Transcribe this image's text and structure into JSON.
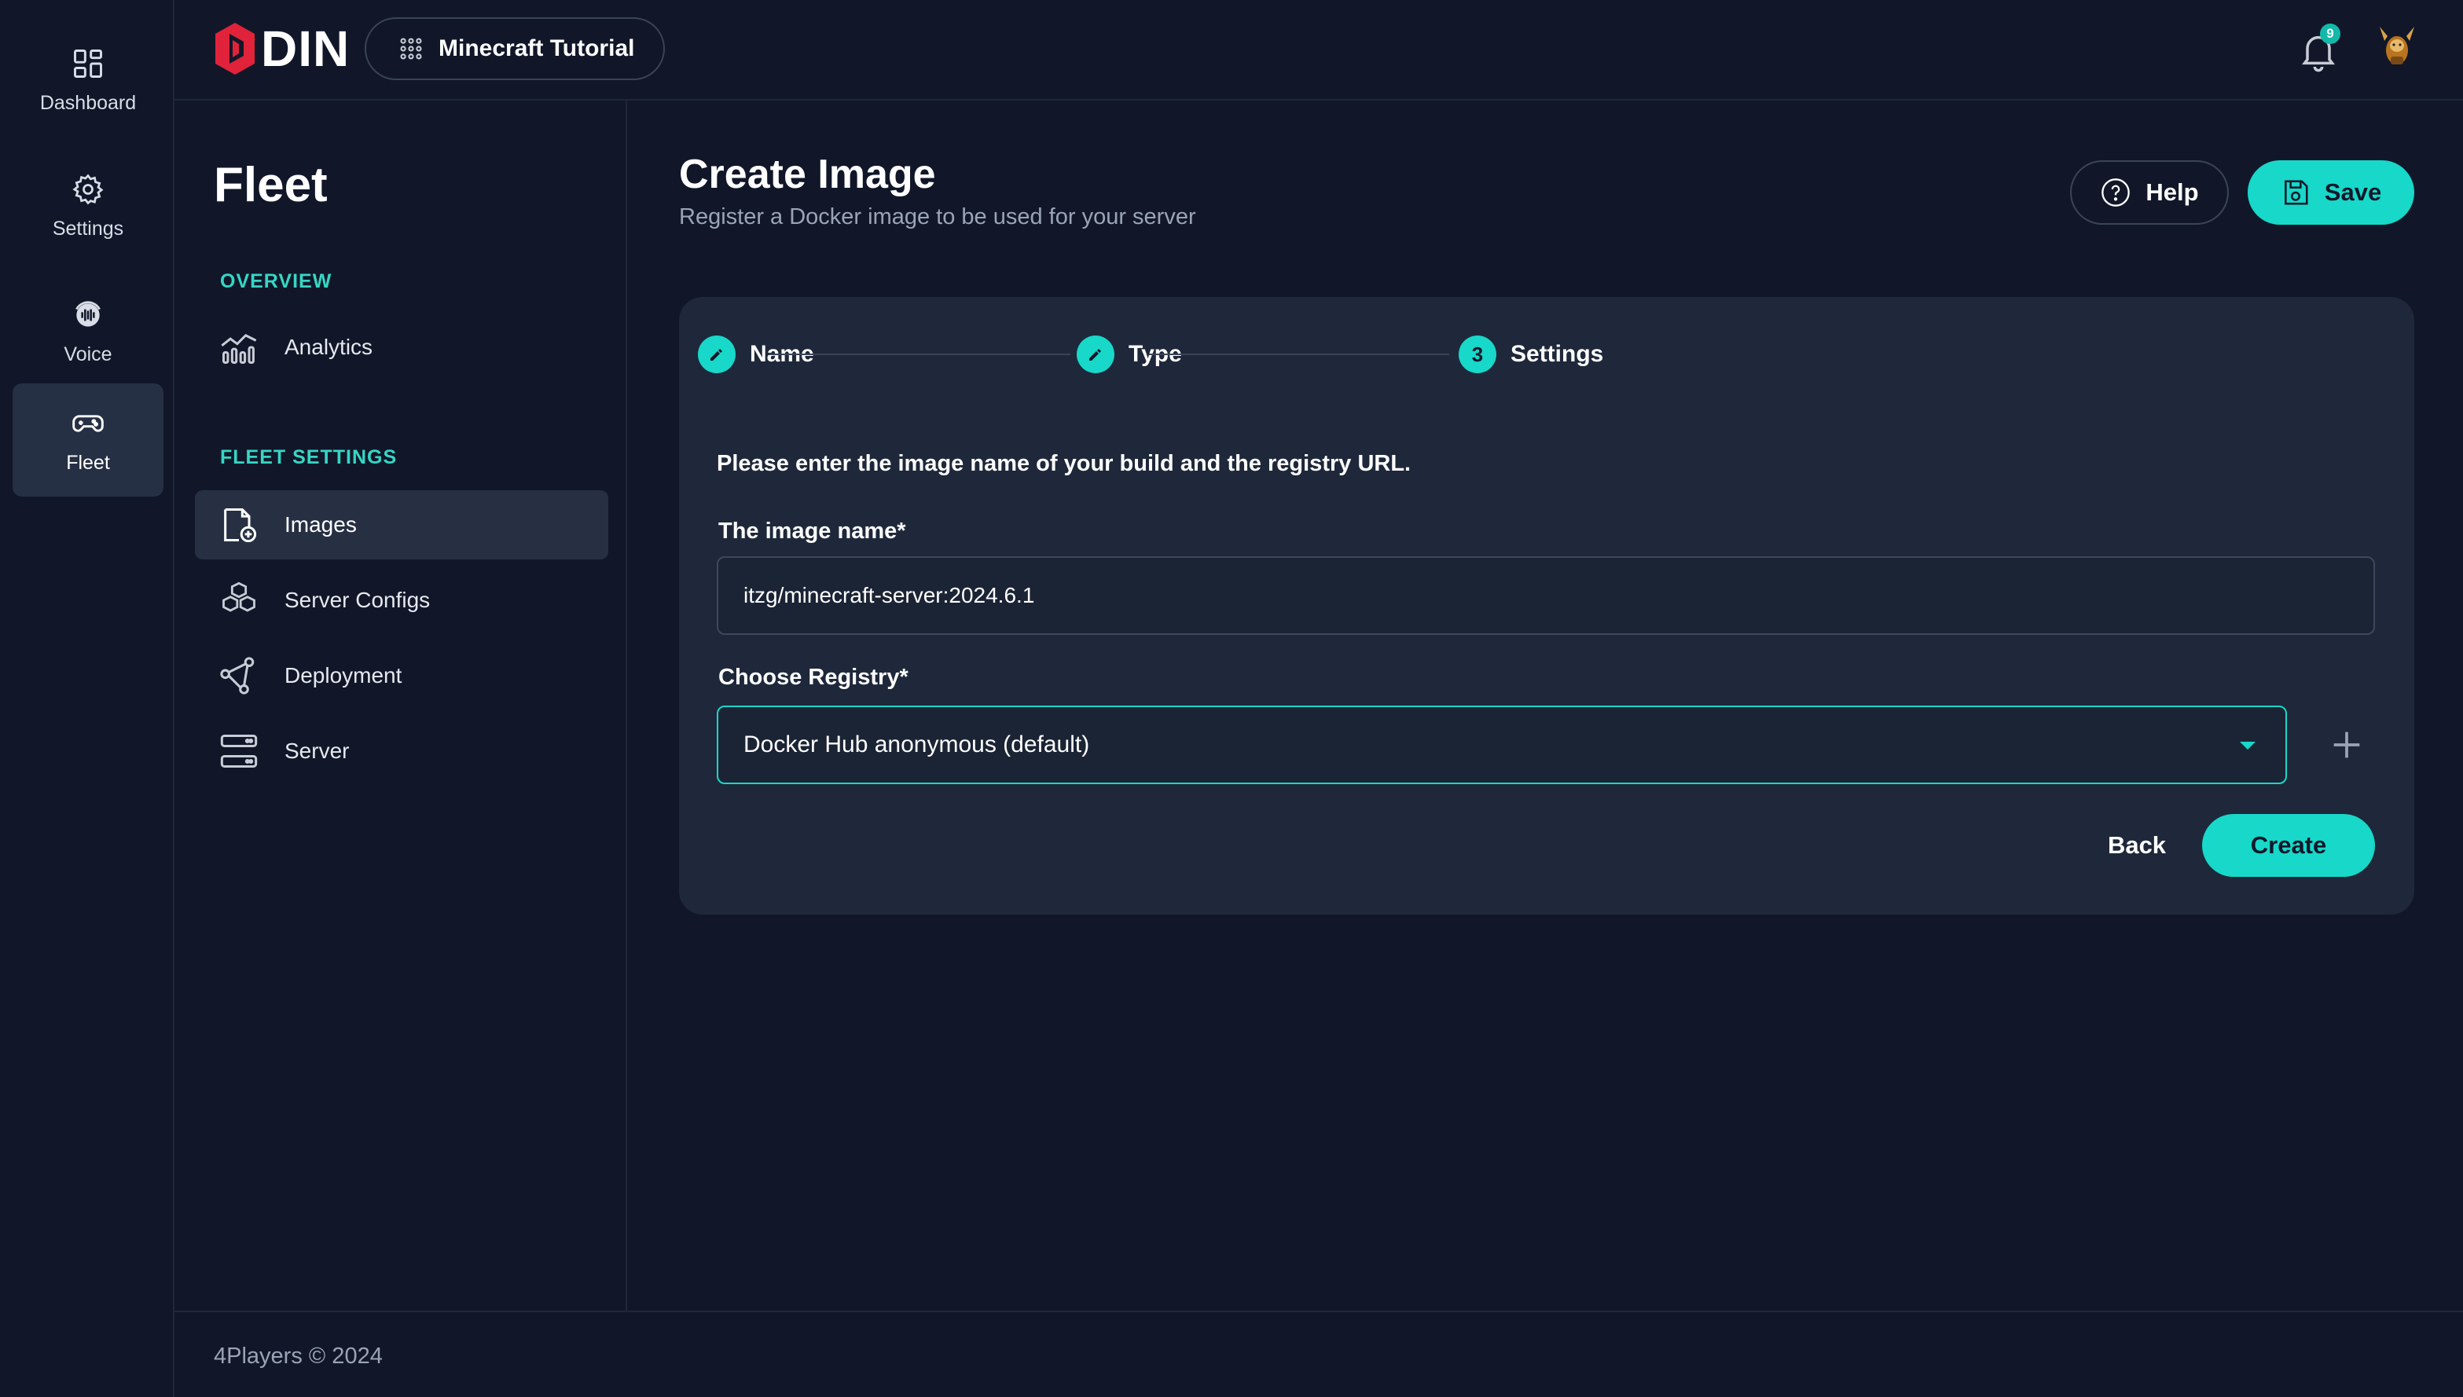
{
  "app": {
    "logo_text": "DIN",
    "project_name": "Minecraft Tutorial",
    "notification_count": "9",
    "brand_color": "#17d8c9"
  },
  "rail": {
    "items": [
      {
        "label": "Dashboard",
        "icon": "dashboard-icon"
      },
      {
        "label": "Settings",
        "icon": "gear-icon"
      },
      {
        "label": "Voice",
        "icon": "voice-icon"
      },
      {
        "label": "Fleet",
        "icon": "gamepad-icon",
        "active": true
      }
    ]
  },
  "sidebar": {
    "title": "Fleet",
    "overview_label": "OVERVIEW",
    "fleet_settings_label": "FLEET SETTINGS",
    "items": [
      {
        "label": "Analytics",
        "icon": "analytics-icon"
      },
      {
        "label": "Images",
        "icon": "image-file-icon",
        "active": true
      },
      {
        "label": "Server Configs",
        "icon": "cubes-icon"
      },
      {
        "label": "Deployment",
        "icon": "network-icon"
      },
      {
        "label": "Server",
        "icon": "server-icon"
      }
    ]
  },
  "main": {
    "title": "Create Image",
    "subtitle": "Register a Docker image to be used for your server",
    "help_label": "Help",
    "save_label": "Save",
    "steps": [
      {
        "label": "Name",
        "state": "done"
      },
      {
        "label": "Type",
        "state": "done"
      },
      {
        "label": "Settings",
        "state": "current",
        "number": "3"
      }
    ],
    "instruction": "Please enter the image name of your build and the registry URL.",
    "image_name_label": "The image name*",
    "image_name_value": "itzg/minecraft-server:2024.6.1",
    "registry_label": "Choose Registry*",
    "registry_value": "Docker Hub anonymous (default)",
    "back_label": "Back",
    "create_label": "Create"
  },
  "footer": {
    "text": "4Players © 2024"
  }
}
